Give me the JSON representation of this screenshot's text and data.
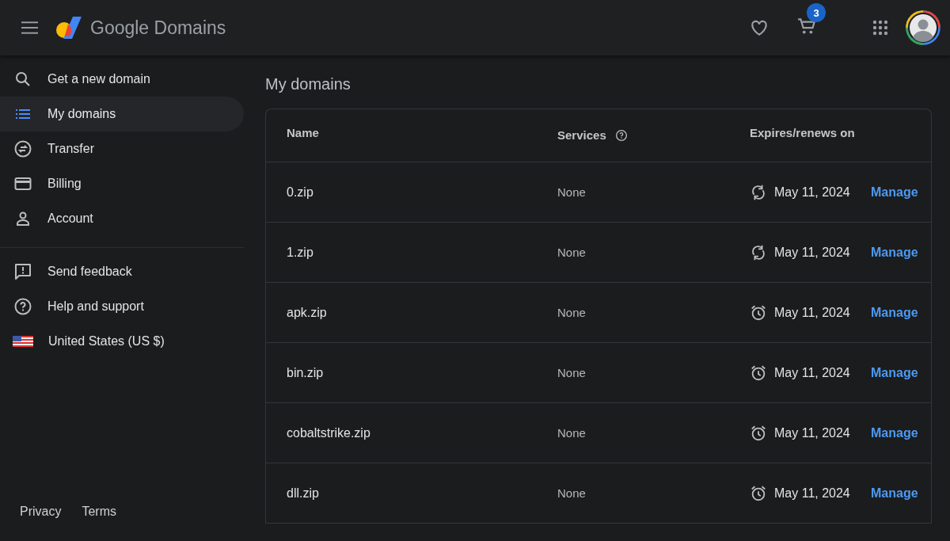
{
  "header": {
    "brand": "Google Domains",
    "cart_count": "3"
  },
  "sidebar": {
    "items": [
      {
        "label": "Get a new domain",
        "kind": "search",
        "selected": false
      },
      {
        "label": "My domains",
        "kind": "list",
        "selected": true
      },
      {
        "label": "Transfer",
        "kind": "transfer",
        "selected": false
      },
      {
        "label": "Billing",
        "kind": "card",
        "selected": false
      },
      {
        "label": "Account",
        "kind": "person",
        "selected": false
      }
    ],
    "secondary_items": [
      {
        "label": "Send feedback",
        "kind": "feedback"
      },
      {
        "label": "Help and support",
        "kind": "help"
      },
      {
        "label": "United States (US $)",
        "kind": "flag"
      }
    ],
    "footer_links": [
      "Privacy",
      "Terms"
    ]
  },
  "main": {
    "title": "My domains",
    "table": {
      "columns": [
        "Name",
        "Services",
        "Expires/renews on"
      ],
      "rows": [
        {
          "name": "0.zip",
          "services": "None",
          "kind": "renew",
          "date": "May 11, 2024",
          "action": "Manage"
        },
        {
          "name": "1.zip",
          "services": "None",
          "kind": "renew",
          "date": "May 11, 2024",
          "action": "Manage"
        },
        {
          "name": "apk.zip",
          "services": "None",
          "kind": "expire",
          "date": "May 11, 2024",
          "action": "Manage"
        },
        {
          "name": "bin.zip",
          "services": "None",
          "kind": "expire",
          "date": "May 11, 2024",
          "action": "Manage"
        },
        {
          "name": "cobaltstrike.zip",
          "services": "None",
          "kind": "expire",
          "date": "May 11, 2024",
          "action": "Manage"
        },
        {
          "name": "dll.zip",
          "services": "None",
          "kind": "expire",
          "date": "May 11, 2024",
          "action": "Manage"
        }
      ]
    }
  }
}
